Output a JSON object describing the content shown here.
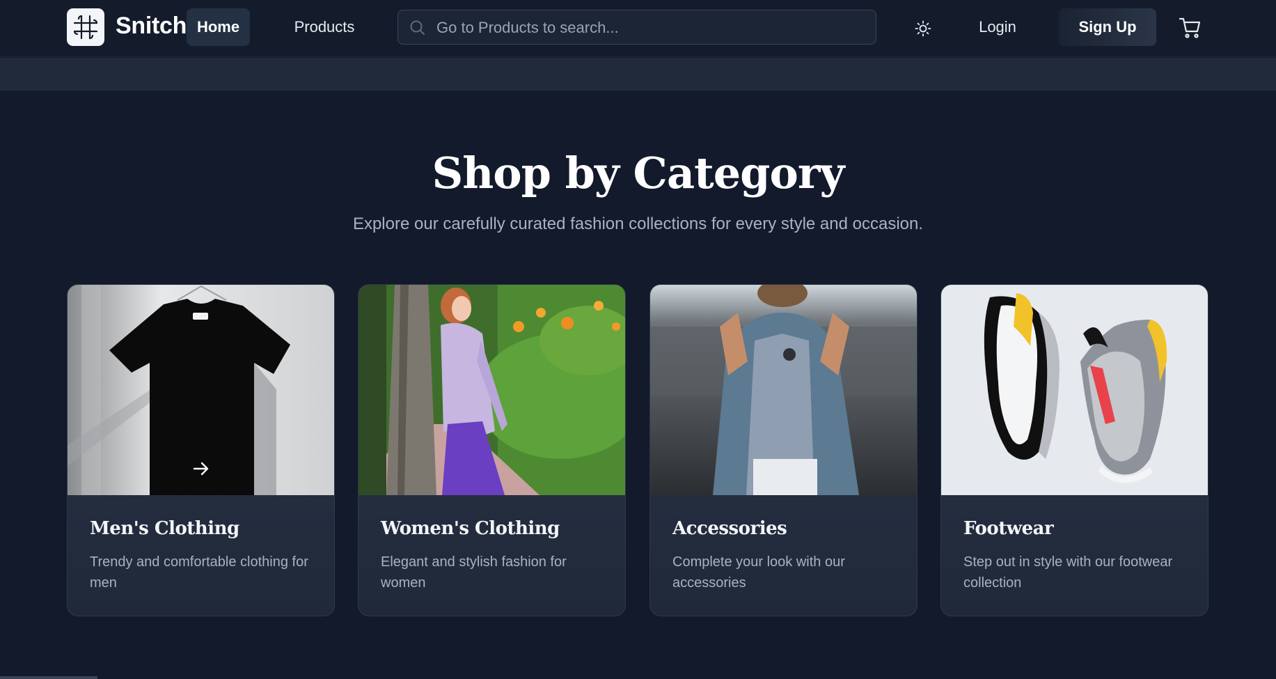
{
  "header": {
    "brand": "Snitch",
    "logo_icon": "grid-knot-logo-icon",
    "nav": [
      {
        "label": "Home",
        "active": true
      },
      {
        "label": "Products",
        "active": false
      }
    ],
    "search": {
      "placeholder": "Go to Products to search...",
      "icon": "search-icon"
    },
    "theme_icon": "sun-icon",
    "login_label": "Login",
    "signup_label": "Sign Up",
    "cart_icon": "cart-icon"
  },
  "section": {
    "title": "Shop by Category",
    "subtitle": "Explore our carefully curated fashion collections for every style and occasion."
  },
  "categories": [
    {
      "title": "Men's Clothing",
      "description": "Trendy and comfortable clothing for men",
      "image": "black t-shirt on hanger",
      "hover_icon": "arrow-right-icon"
    },
    {
      "title": "Women's Clothing",
      "description": "Elegant and stylish fashion for women",
      "image": "woman in purple skirt by tree"
    },
    {
      "title": "Accessories",
      "description": "Complete your look with our accessories",
      "image": "man in denim jacket"
    },
    {
      "title": "Footwear",
      "description": "Step out in style with our footwear collection",
      "image": "pair of grey sneakers"
    }
  ],
  "colors": {
    "background": "#121a2b",
    "navbar": "#141c2c",
    "card": "#2a3547",
    "muted_text": "#aab3c1"
  }
}
